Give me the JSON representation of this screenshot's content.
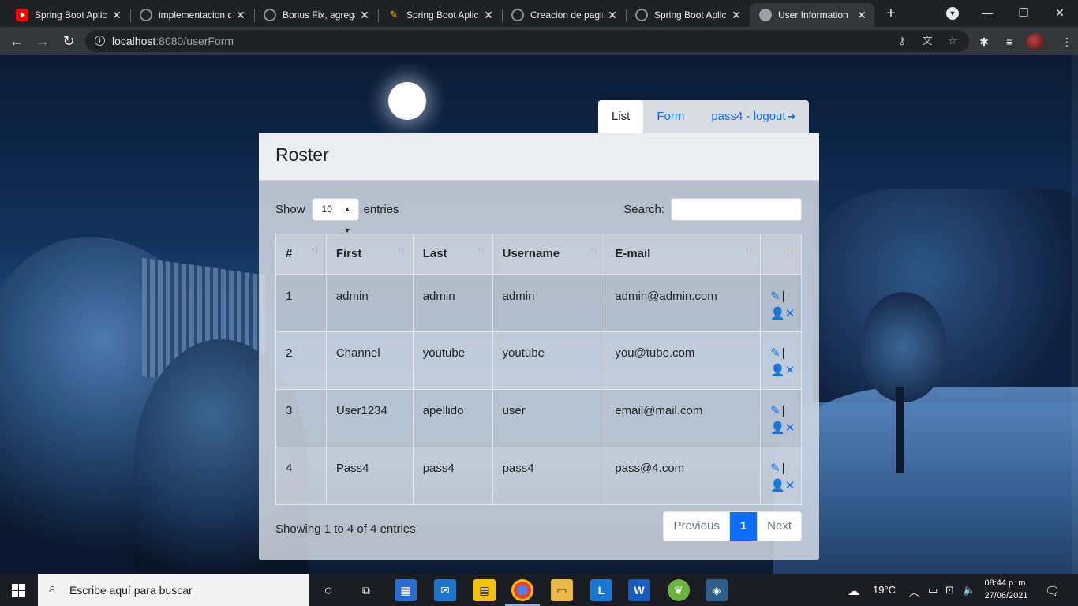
{
  "browser": {
    "tabs": [
      {
        "title": "Spring Boot Aplic",
        "favicon": "youtube-icon"
      },
      {
        "title": "implementacion d",
        "favicon": "github-icon"
      },
      {
        "title": "Bonus Fix, agrega",
        "favicon": "github-icon"
      },
      {
        "title": "Spring Boot Aplic",
        "favicon": "pen-icon"
      },
      {
        "title": "Creacion de pagin",
        "favicon": "github-icon"
      },
      {
        "title": "Spring Boot Aplic",
        "favicon": "github-icon"
      },
      {
        "title": "User Information",
        "favicon": "globe-icon",
        "active": true
      }
    ],
    "url_host": "localhost",
    "url_path": ":8080/userForm"
  },
  "nav": {
    "list_label": "List",
    "form_label": "Form",
    "logout_label": "pass4 - logout"
  },
  "card": {
    "title": "Roster",
    "show_label": "Show",
    "entries_label": "entries",
    "page_length": "10",
    "search_label": "Search:",
    "search_value": ""
  },
  "table": {
    "headers": [
      "#",
      "First",
      "Last",
      "Username",
      "E-mail",
      ""
    ],
    "rows": [
      {
        "id": "1",
        "first": "admin",
        "last": "admin",
        "username": "admin",
        "email": "admin@admin.com"
      },
      {
        "id": "2",
        "first": "Channel",
        "last": "youtube",
        "username": "youtube",
        "email": "you@tube.com"
      },
      {
        "id": "3",
        "first": "User1234",
        "last": "apellido",
        "username": "user",
        "email": "email@mail.com"
      },
      {
        "id": "4",
        "first": "Pass4",
        "last": "pass4",
        "username": "pass4",
        "email": "pass@4.com"
      }
    ],
    "action_separator": "|"
  },
  "footer": {
    "info": "Showing 1 to 4 of 4 entries",
    "previous_label": "Previous",
    "current_page": "1",
    "next_label": "Next"
  },
  "taskbar": {
    "search_placeholder": "Escribe aquí para buscar",
    "temperature": "19°C",
    "time": "08:44 p. m.",
    "date": "27/06/2021"
  },
  "colors": {
    "accent": "#0d6efd",
    "chrome_dark": "#202124",
    "chrome_toolbar": "#35363a"
  }
}
